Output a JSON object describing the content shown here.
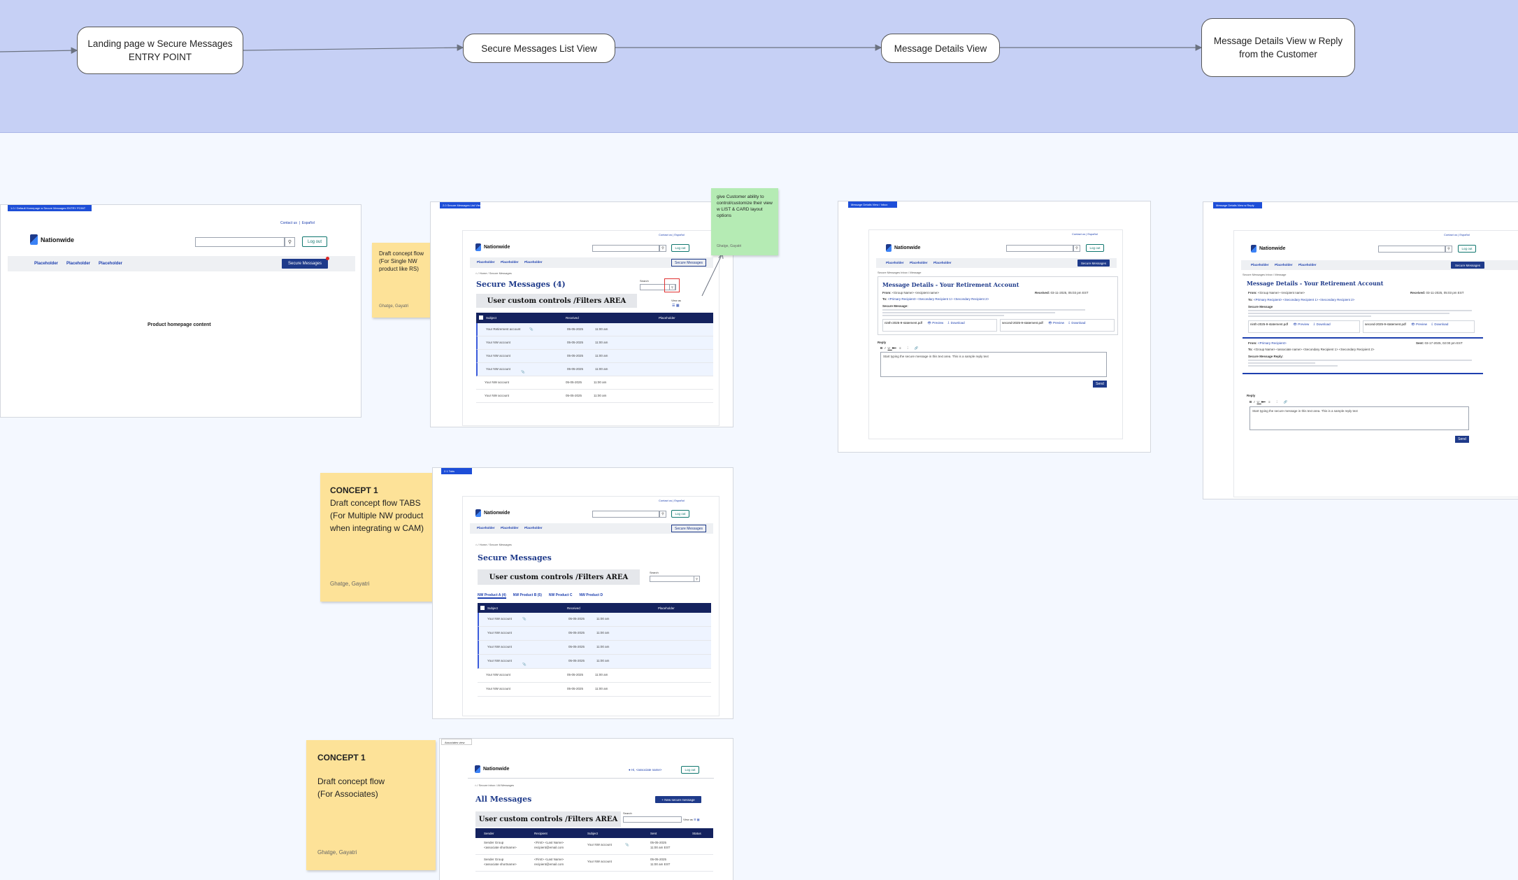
{
  "flow": {
    "stages": [
      {
        "label": "Landing page w Secure Messages\nENTRY POINT"
      },
      {
        "label": "Secure Messages List View"
      },
      {
        "label": "Message Details View"
      },
      {
        "label": "Message Details View w Reply\nfrom the Customer"
      }
    ]
  },
  "colors": {
    "band": "#c6d0f5",
    "canvas": "#f4f8ff",
    "sticky_yellow": "#fde298",
    "sticky_green": "#b5ebb4",
    "brand_navy": "#1e3a8a"
  },
  "common": {
    "brand": "Nationwide",
    "contact_us": "Contact us",
    "espanol": "Español",
    "log_out": "Log out",
    "nav": [
      "Placeholder",
      "Placeholder",
      "Placeholder"
    ],
    "secure_messages_btn": "Secure Messages",
    "search_label": "Search",
    "view_as": "View as"
  },
  "landing": {
    "frame_tag": "1.0 / Default Homepage w Secure Messages ENTRY POINT",
    "content": "Product  homepage content"
  },
  "list_view": {
    "frame_tag": "2.0 Secure Messages List View",
    "breadcrumb_home": "Home",
    "breadcrumb_current": "Secure Messages",
    "title": "Secure Messages (4)",
    "filters": "User custom controls /Filters AREA",
    "columns": [
      "Subject",
      "Received",
      "Placeholder"
    ],
    "rows": [
      {
        "subject": "Your Retirement account",
        "date": "05-05-2025",
        "time": "11:00 am",
        "unread": true
      },
      {
        "subject": "Your NW account",
        "date": "05-05-2025",
        "time": "11:00 am",
        "unread": true
      },
      {
        "subject": "Your NW account",
        "date": "05-05-2025",
        "time": "11:00 am",
        "unread": true
      },
      {
        "subject": "Your NW account",
        "date": "05-05-2025",
        "time": "11:00 am",
        "unread": true
      },
      {
        "subject": "Your NW account",
        "date": "05-05-2025",
        "time": "11:00 am",
        "unread": false
      },
      {
        "subject": "Your NW account",
        "date": "05-05-2025",
        "time": "11:00 am",
        "unread": false
      }
    ]
  },
  "tabs_view": {
    "frame_tag": "2.1 Tabs",
    "breadcrumb_home": "Home",
    "breadcrumb_current": "Secure Messages",
    "title": "Secure Messages",
    "filters": "User custom controls /Filters AREA",
    "tabs": [
      "NW Product A (4)",
      "NW Product B (5)",
      "NW Product C",
      "NW Product D"
    ],
    "columns": [
      "Subject",
      "Received",
      "Placeholder"
    ],
    "rows": [
      {
        "subject": "Your NW account",
        "date": "05-05-2025",
        "time": "11:00 am",
        "unread": true
      },
      {
        "subject": "Your NW account",
        "date": "05-05-2025",
        "time": "11:00 am",
        "unread": true
      },
      {
        "subject": "Your NW account",
        "date": "05-05-2025",
        "time": "11:00 am",
        "unread": true
      },
      {
        "subject": "Your NW account",
        "date": "05-05-2025",
        "time": "11:00 am",
        "unread": true
      },
      {
        "subject": "Your NW account",
        "date": "05-05-2025",
        "time": "11:00 am",
        "unread": false
      },
      {
        "subject": "Your NW account",
        "date": "05-05-2025",
        "time": "11:00 am",
        "unread": false
      }
    ]
  },
  "assoc_view": {
    "frame_tag": "Associates view",
    "breadcrumb_home": "Home",
    "breadcrumb_mid": "Secure inbox",
    "breadcrumb_current": "All Messages",
    "user": "Hi, <associate name>",
    "title": "All Messages",
    "new_msg_btn": "+ New secure message",
    "filters": "User custom controls /Filters AREA",
    "columns": [
      "Sender",
      "Recipient",
      "Subject",
      "Sent",
      "Status"
    ],
    "rows": [
      {
        "sender": "Sender Group",
        "sender_sub": "<associate shortname>",
        "recipient": "&lt;First&gt; &lt;Last Name&gt;",
        "recipient_sub": "recipient@email.com",
        "subject": "Your NW account",
        "date": "05-05-2025",
        "time": "11:00 am EST"
      },
      {
        "sender": "Sender Group",
        "sender_sub": "<associate shortname>",
        "recipient": "&lt;First&gt; &lt;Last Name&gt;",
        "recipient_sub": "recipient@email.com",
        "subject": "Your NW account",
        "date": "05-05-2025",
        "time": "11:00 am EST"
      }
    ]
  },
  "details_view": {
    "frame_tag": "Message Details View / Inbox",
    "breadcrumb": "Secure Messages Inbox / Message",
    "title": "Message Details - Your Retirement Account",
    "from_label": "From:",
    "from_value": "<Group Name> <recipient name>",
    "received_label": "Received:",
    "received_value": "03-11-2025, 05:03 pm EST",
    "to_label": "To:",
    "to_value": "<Primary Recipient>  <Secondary Recipient 1>  <Secondary Recipient 2>",
    "secure_message_label": "Secure Message:",
    "attachments": [
      "ninth-2025-9-statement.pdf",
      "second-2025-9-statement.pdf"
    ],
    "preview": "Preview",
    "download": "Download",
    "reply_label": "Reply",
    "reply_text": "Start typing the secure message in this text area. This is a sample reply text",
    "send": "Send"
  },
  "reply_view": {
    "frame_tag": "Message Details View w Reply",
    "breadcrumb": "Secure Messages Inbox / Message",
    "title": "Message Details - Your Retirement Account",
    "from_label": "From:",
    "from_value": "<Group Name> <recipient name>",
    "received_label": "Received:",
    "received_value": "03-11-2025, 05:03 pm EST",
    "to_label": "To:",
    "to_value": "<Primary Recipient>  <Secondary Recipient 1>  <Secondary Recipient 2>",
    "secure_message_label": "Secure Message",
    "attachments": [
      "ninth-2025-9-statement.pdf",
      "second-2025-9-statement.pdf"
    ],
    "preview": "Preview",
    "download": "Download",
    "reply_from_label": "From:",
    "reply_from_value": "<Primary Recipient>",
    "reply_sent_label": "Sent:",
    "reply_sent_value": "03-17-2025, 02:00 pm EST",
    "reply_to_label": "To:",
    "reply_to_value": "<Group Name> <associate name>  <Secondary Recipient 1>  <Secondary Recipient 2>",
    "reply_msg_label": "Secure Message Reply:",
    "reply_label": "Reply",
    "reply_text": "Start typing the secure message in this text area. This is a sample reply text",
    "send": "Send"
  },
  "stickies": {
    "single": {
      "title": "",
      "body": "Draft concept flow\n(For Single NW\nproduct like RS)",
      "author": "Ghatge, Gayatri"
    },
    "green": {
      "body": "give Customer ability to control/customize their view w LIST & CARD layout options",
      "author": "Ghatge, Gayatri"
    },
    "tabs": {
      "title": "CONCEPT 1",
      "body": "Draft concept flow TABS\n(For Multiple NW product\nwhen integrating w CAM)",
      "author": "Ghatge, Gayatri"
    },
    "assoc": {
      "title": "CONCEPT 1",
      "body": "Draft concept flow\n(For Associates)",
      "author": "Ghatge, Gayatri"
    }
  }
}
